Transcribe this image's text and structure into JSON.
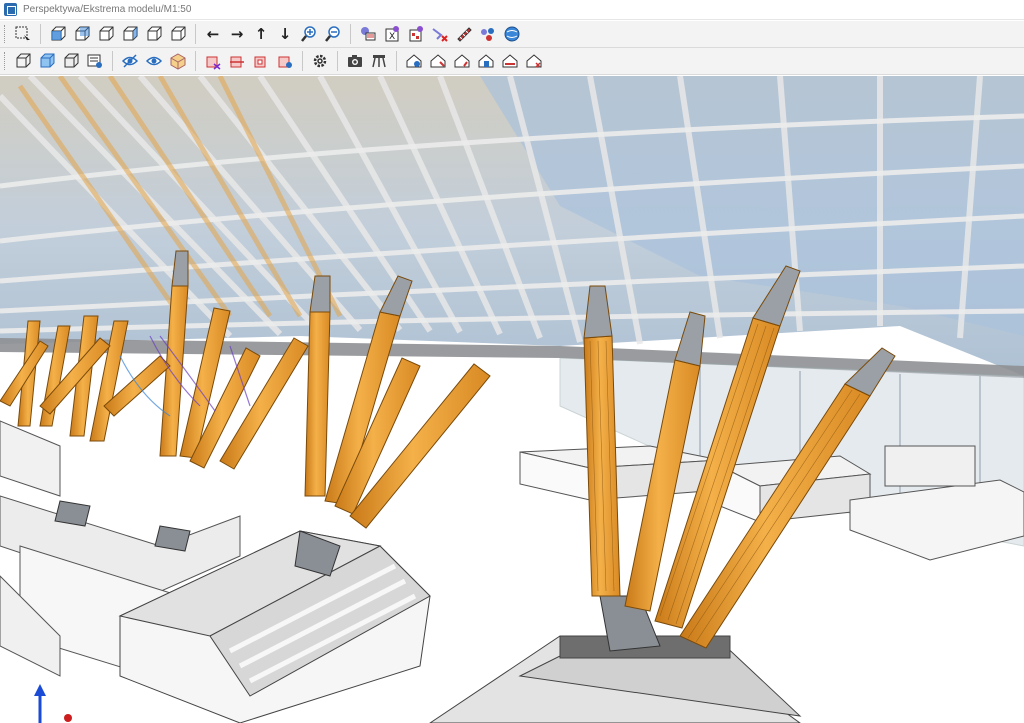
{
  "window": {
    "title": "Perspektywa/Ekstrema modelu/M1:50"
  },
  "toolbar_row1": {
    "groups": [
      [
        "select-window-icon"
      ],
      [
        "view-cube-front-icon",
        "view-cube-back-icon",
        "view-cube-left-icon",
        "view-cube-right-icon",
        "view-cube-top-icon",
        "view-cube-bottom-icon"
      ],
      [
        "pan-left-arrow-icon",
        "pan-right-arrow-icon",
        "pan-up-arrow-icon",
        "pan-down-arrow-icon",
        "zoom-in-icon",
        "zoom-out-icon"
      ],
      [
        "layers-icon",
        "excel-export-icon",
        "filter-icon",
        "remove-filter-icon",
        "measure-icon",
        "network-icon",
        "globe-icon"
      ]
    ]
  },
  "toolbar_row2": {
    "groups": [
      [
        "wireframe-cube-icon",
        "shaded-cube-icon",
        "solid-cube-icon",
        "view-settings-icon"
      ],
      [
        "hide-icon",
        "show-icon",
        "isolate-box-icon"
      ],
      [
        "section-box-icon",
        "section-plane-icon",
        "section-clear-icon",
        "section-settings-icon"
      ],
      [
        "gear-icon"
      ],
      [
        "camera-icon",
        "walk-icon"
      ],
      [
        "render-icon-1",
        "render-icon-2",
        "render-icon-3",
        "render-icon-4",
        "render-icon-5",
        "render-icon-6"
      ]
    ]
  },
  "colors": {
    "timber": "#f0a23a",
    "timber_dark": "#c77a1a",
    "glass": "#b9cde0",
    "steel": "#9aa0a6",
    "concrete": "#e9e9e9",
    "axis_z": "#1a4bd6",
    "axis_x": "#cc1e1e"
  }
}
